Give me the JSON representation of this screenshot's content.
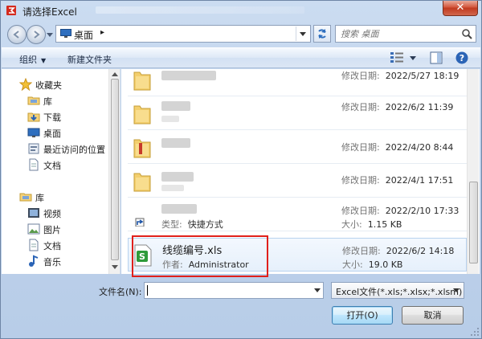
{
  "window": {
    "title": "请选择Excel",
    "close_label": "✕"
  },
  "address": {
    "location": "桌面",
    "chevron": "▸"
  },
  "search": {
    "placeholder": "搜索 桌面"
  },
  "toolbar": {
    "organize_label": "组织",
    "new_folder_label": "新建文件夹"
  },
  "sidebar": {
    "favorites": {
      "label": "收藏夹",
      "icon": "star-icon"
    },
    "favorites_items": [
      {
        "label": "库",
        "icon": "library-icon"
      },
      {
        "label": "下载",
        "icon": "download-folder-icon"
      },
      {
        "label": "桌面",
        "icon": "desktop-icon"
      },
      {
        "label": "最近访问的位置",
        "icon": "recent-places-icon"
      },
      {
        "label": "文档",
        "icon": "document-icon"
      }
    ],
    "libraries": {
      "label": "库",
      "icon": "library-icon"
    },
    "libraries_items": [
      {
        "label": "视频",
        "icon": "video-icon"
      },
      {
        "label": "图片",
        "icon": "picture-icon"
      },
      {
        "label": "文档",
        "icon": "document-icon"
      },
      {
        "label": "音乐",
        "icon": "music-icon"
      }
    ]
  },
  "files": {
    "modified_label": "修改日期:",
    "type_label": "类型:",
    "size_label": "大小:",
    "author_label": "作者:",
    "items": [
      {
        "kind": "folder",
        "modified": "2022/5/27 18:19"
      },
      {
        "kind": "folder",
        "modified": "2022/6/2 11:39"
      },
      {
        "kind": "folder",
        "modified": "2022/4/20 8:44"
      },
      {
        "kind": "folder",
        "modified": "2022/4/1 17:51"
      },
      {
        "kind": "shortcut",
        "type": "快捷方式",
        "modified": "2022/2/10 17:33",
        "size": "1.15 KB"
      },
      {
        "kind": "xls",
        "name": "线缆编号.xls",
        "author": "Administrator",
        "modified": "2022/6/2 14:18",
        "size": "19.0 KB"
      }
    ]
  },
  "bottom": {
    "filename_label": "文件名(N):",
    "filename_value": "",
    "filetype_value": "Excel文件(*.xls;*.xlsx;*.xlsm)",
    "open_label": "打开(O)",
    "cancel_label": "取消"
  },
  "colors": {
    "accent": "#3c7fb1",
    "highlight_box": "#e0201b",
    "excel_green": "#2e9b3a"
  }
}
